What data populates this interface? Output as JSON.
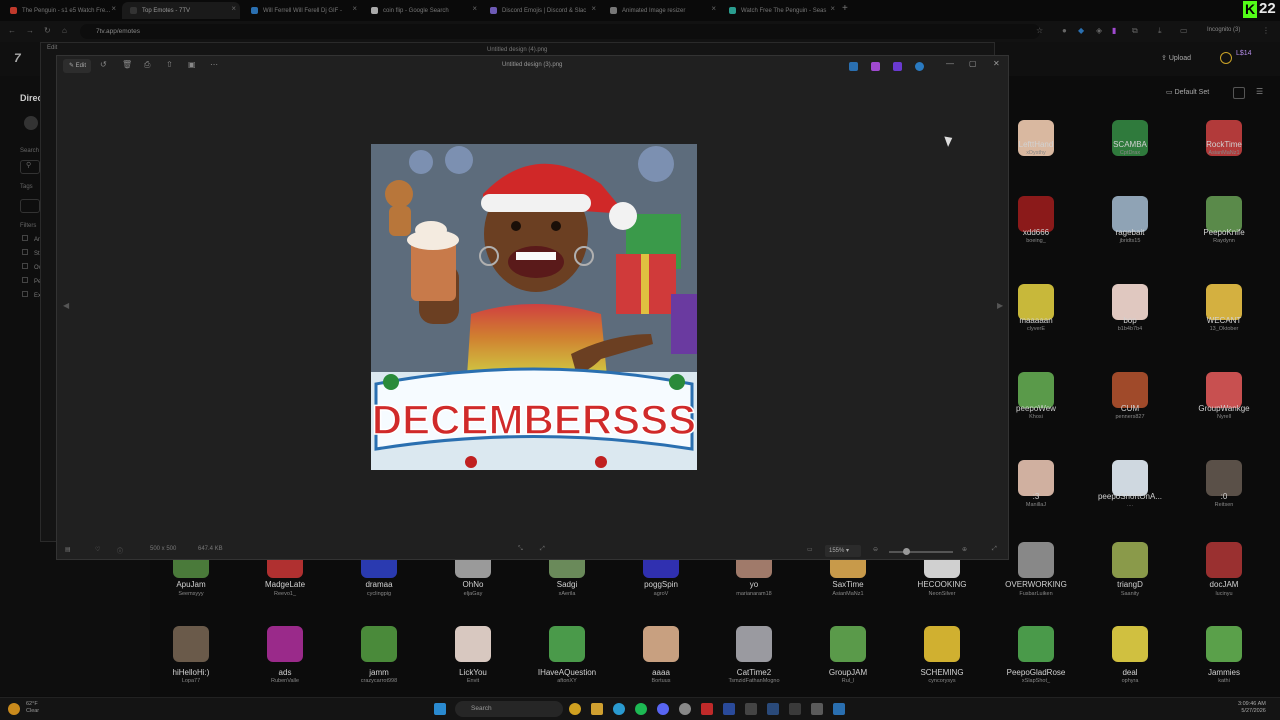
{
  "browser": {
    "tabs": [
      {
        "label": "The Penguin - s1 e5 Watch Fre...",
        "fav": "#c0392b"
      },
      {
        "label": "Top Emotes - 7TV",
        "fav": "#333"
      },
      {
        "label": "Will Ferrell Will Ferell Dj GIF -",
        "fav": "#2a6fb0"
      },
      {
        "label": "coin flip - Google Search",
        "fav": "#aaa"
      },
      {
        "label": "Discord Emojis | Discord & Slac",
        "fav": "#6d5ab5"
      },
      {
        "label": "Animated Image resizer",
        "fav": "#777"
      },
      {
        "label": "Watch Free The Penguin - Seas",
        "fav": "#2a9d8f"
      }
    ],
    "kick_badge": "K",
    "kick_count": "22",
    "url": "7tv.app/emotes",
    "incognito": "Incognito (3)"
  },
  "app": {
    "upload_label": "Upload",
    "balance": "L$14",
    "left_title": "Direc",
    "search_label": "Search",
    "tags_label": "Tags",
    "filters_label": "Filters",
    "filter_items": [
      "An",
      "St",
      "Ov",
      "Pe",
      "Ex"
    ],
    "default_set": "Default Set"
  },
  "behind_window": {
    "title": "Untitled design (4).png",
    "edit": "Edit"
  },
  "viewer": {
    "edit_label": "Edit",
    "title": "Untitled design (3).png",
    "image_caption": "DECEMBERSSS",
    "dimensions": "500 x 500",
    "filesize": "647.4 KB",
    "zoom": "155%"
  },
  "emotes_right": [
    {
      "name": "LefttHand",
      "owner": "xDysthy",
      "color": "#d9b8a0"
    },
    {
      "name": "SCAMBA",
      "owner": "CptDrax",
      "color": "#2f7a3c"
    },
    {
      "name": "RockTime",
      "owner": "AsianMaNz1",
      "color": "#b23a3a"
    },
    {
      "name": "xdd666",
      "owner": "boeing_",
      "color": "#8b1a1a"
    },
    {
      "name": "ragebait",
      "owner": "jbridts15",
      "color": "#8fa3b5"
    },
    {
      "name": "PeepoKnife",
      "owner": "Raydynn",
      "color": "#5a8a4a"
    },
    {
      "name": "maaaaan",
      "owner": "clyverE",
      "color": "#c8b83a"
    },
    {
      "name": "bop",
      "owner": "b1b4b7b4",
      "color": "#e0c8c0"
    },
    {
      "name": "WECANT",
      "owner": "13_Oktober",
      "color": "#d4b040"
    },
    {
      "name": "peepoWew",
      "owner": "Khosi",
      "color": "#5a9a4a"
    },
    {
      "name": "CUM",
      "owner": "penners827",
      "color": "#a04a2a"
    },
    {
      "name": "GroupWankge",
      "owner": "Nyrell",
      "color": "#c85050"
    },
    {
      "name": ":3",
      "owner": "ManillaJ",
      "color": "#d0b0a0"
    },
    {
      "name": "peepoShortOnA...",
      "owner": "....",
      "color": "#cfd8e0"
    },
    {
      "name": ":0",
      "owner": "Reitsen",
      "color": "#5a5048"
    }
  ],
  "emotes_row9": [
    {
      "name": "ApuJam",
      "owner": "Seemsyyy",
      "color": "#4a7a3a"
    },
    {
      "name": "MadgeLate",
      "owner": "Reevo1_",
      "color": "#b03030"
    },
    {
      "name": "dramaa",
      "owner": "cyclingpig",
      "color": "#2a3ab0"
    },
    {
      "name": "OhNo",
      "owner": "eljaGay",
      "color": "#9a9a9a"
    },
    {
      "name": "Sadgi",
      "owner": "xAerila",
      "color": "#6a8a5a"
    },
    {
      "name": "poggSpin",
      "owner": "agroV",
      "color": "#3030b0"
    },
    {
      "name": "yo",
      "owner": "marianaram18",
      "color": "#a07a6a"
    },
    {
      "name": "SaxTime",
      "owner": "AsianMaNz1",
      "color": "#c89a4a"
    },
    {
      "name": "HECOOKING",
      "owner": "NeonSilver",
      "color": "#d0d0d0"
    },
    {
      "name": "OVERWORKING",
      "owner": "FusbarLuiken",
      "color": "#888"
    },
    {
      "name": "triangD",
      "owner": "Saanity",
      "color": "#8a9a4a"
    },
    {
      "name": "docJAM",
      "owner": "lucinyu",
      "color": "#9a3030"
    }
  ],
  "emotes_row10": [
    {
      "name": "hiHelloHi:)",
      "owner": "Lopa77",
      "color": "#6a5a4a"
    },
    {
      "name": "ads",
      "owner": "RubenValle",
      "color": "#9a2a8a"
    },
    {
      "name": "jamm",
      "owner": "crazycarrot998",
      "color": "#4a8a3a"
    },
    {
      "name": "LickYou",
      "owner": "Envit",
      "color": "#d8c8c0"
    },
    {
      "name": "IHaveAQuestion",
      "owner": "aftonXY",
      "color": "#4a9a4a"
    },
    {
      "name": "aaaa",
      "owner": "Bortuus",
      "color": "#c8a080"
    },
    {
      "name": "CatTime2",
      "owner": "TsmzidFathanMogno",
      "color": "#9a9aa0"
    },
    {
      "name": "GroupJAM",
      "owner": "Rul_l",
      "color": "#5a9a4a"
    },
    {
      "name": "SCHEMING",
      "owner": "cyncorysys",
      "color": "#d0b030"
    },
    {
      "name": "PeepoGladRose",
      "owner": "xSlapShot_",
      "color": "#4a9a4a"
    },
    {
      "name": "deal",
      "owner": "ophyra",
      "color": "#d0c040"
    },
    {
      "name": "Jammies",
      "owner": "kathi",
      "color": "#5aa04a"
    }
  ],
  "taskbar": {
    "temp": "62°F",
    "condition": "Clear",
    "search": "Search",
    "time": "3:09:46 AM",
    "date": "5/27/2026"
  }
}
